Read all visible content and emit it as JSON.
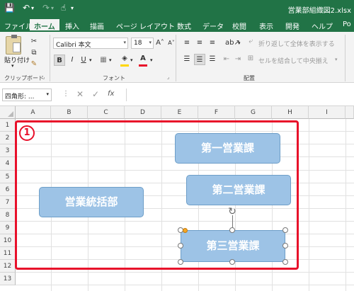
{
  "title_bar": {
    "filename": "営業部組織図2.xlsx",
    "icons": [
      "save-icon",
      "undo-icon",
      "redo-icon",
      "touch-mode-icon"
    ]
  },
  "tabs": [
    "ファイル",
    "ホーム",
    "挿入",
    "描画",
    "ページ レイアウト",
    "数式",
    "データ",
    "校閲",
    "表示",
    "開発",
    "ヘルプ",
    "Po"
  ],
  "ribbon": {
    "clipboard": {
      "paste_label": "貼り付け",
      "group_label": "クリップボード"
    },
    "font": {
      "font_name": "Calibri 本文",
      "font_size": "18",
      "group_label": "フォント",
      "bold": "B",
      "italic": "I",
      "underline": "U",
      "grow": "A˄",
      "shrink": "A˅"
    },
    "alignment": {
      "wrap_text": "折り返して全体を表示する",
      "merge_center": "セルを結合して中央揃え",
      "group_label": "配置"
    }
  },
  "formula_bar": {
    "name_box": "四角形: ...",
    "fx": "fx"
  },
  "sheet": {
    "columns": [
      "A",
      "B",
      "C",
      "D",
      "E",
      "F",
      "G",
      "H",
      "I"
    ],
    "rows": [
      "1",
      "2",
      "3",
      "4",
      "5",
      "6",
      "7",
      "8",
      "9",
      "10",
      "11",
      "12",
      "13"
    ],
    "annotation": "1",
    "shapes": [
      "営業統括部",
      "第一営業課",
      "第二営業課",
      "第三営業課"
    ]
  },
  "colors": {
    "excel_green": "#217346",
    "shape_fill": "#9dc3e6",
    "highlight": "#e8102a"
  }
}
